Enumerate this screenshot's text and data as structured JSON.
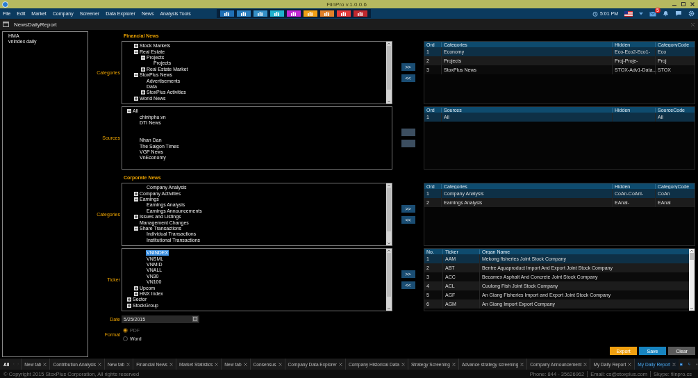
{
  "title_bar": {
    "title": "FiinPro v.1.0.0.6"
  },
  "menu": [
    "File",
    "Edit",
    "Market",
    "Company",
    "Screener",
    "Data Explorer",
    "News",
    "Analysis Tools"
  ],
  "toolbar": [
    {
      "color": "#1f6fb5"
    },
    {
      "color": "#2a7fc0"
    },
    {
      "color": "#3490c8"
    },
    {
      "color": "#1fb2cf"
    },
    {
      "color": "#c32bd6"
    },
    {
      "color": "#f0a015"
    },
    {
      "color": "#e0812a"
    },
    {
      "color": "#e53a3a"
    },
    {
      "color": "#c0282e"
    }
  ],
  "status": {
    "time": "5:01 PM",
    "mail_badge": "5"
  },
  "document": {
    "title": "NewsDailyReport"
  },
  "reports": [
    "HMA",
    "vnindex daily"
  ],
  "sections": [
    {
      "heading": "Financial News",
      "panels": [
        {
          "label": "Categories",
          "scrollbar": true,
          "buttons": [
            ">>",
            "<<"
          ],
          "tree": [
            {
              "children": [
                {
                  "label": "Stock Markets",
                  "expanded": false
                },
                {
                  "label": "Real Estate",
                  "expanded": true,
                  "children": [
                    {
                      "label": "Projects",
                      "expanded": true,
                      "children": [
                        {
                          "label": "Projects"
                        }
                      ]
                    },
                    {
                      "label": "Real Estate Market",
                      "expanded": false
                    }
                  ]
                },
                {
                  "label": "StoxPlus News",
                  "expanded": true,
                  "children": [
                    {
                      "label": "Advertisements"
                    },
                    {
                      "label": "Data"
                    },
                    {
                      "label": "StoxPlus Activities",
                      "expanded": false
                    }
                  ]
                },
                {
                  "label": "World News",
                  "expanded": false
                }
              ]
            }
          ],
          "table": {
            "columns": [
              "Ord",
              "Categories",
              "Hidden",
              "CategoryCode"
            ],
            "rows": [
              {
                "cells": [
                  "1",
                  "Economy",
                  "Eco-Eco2-Eco1-",
                  "Eco"
                ],
                "selected": true
              },
              {
                "cells": [
                  "2",
                  "Projects",
                  "Proj-Proje-",
                  "Proj"
                ],
                "selected": false
              },
              {
                "cells": [
                  "3",
                  "StoxPlus News",
                  "STOX-Adv1-Data...",
                  "STOX"
                ],
                "selected": false
              }
            ]
          }
        },
        {
          "label": "Sources",
          "tree": [
            {
              "label": "All",
              "expanded": true,
              "children": [
                {
                  "label": "chinhphu.vn"
                },
                {
                  "label": "DTI News"
                },
                {
                  "kind": "blank"
                },
                {
                  "kind": "blank"
                },
                {
                  "label": "Nhan Dan"
                },
                {
                  "label": "The Saigon Times"
                },
                {
                  "label": "VGP News"
                },
                {
                  "label": "VnEconomy"
                }
              ]
            }
          ],
          "table": {
            "columns": [
              "Ord",
              "Sources",
              "Hidden",
              "SourceCode"
            ],
            "rows": [
              {
                "cells": [
                  "1",
                  "All",
                  null,
                  "All"
                ],
                "selected": true
              }
            ]
          }
        }
      ]
    },
    {
      "heading": "Corporate News",
      "panels": [
        {
          "label": "Categories",
          "scrollbar": true,
          "buttons": [
            ">>",
            "<<"
          ],
          "tree": [
            {
              "children": [
                {
                  "children": [
                    {
                      "label": "Company Analysis"
                    }
                  ]
                },
                {
                  "label": "Company Activities",
                  "expanded": false
                },
                {
                  "label": "Earnings",
                  "expanded": true,
                  "children": [
                    {
                      "label": "Earnings Analysis"
                    },
                    {
                      "label": "Earnings Announcements"
                    }
                  ]
                },
                {
                  "label": "Issues and Listings",
                  "expanded": false
                },
                {
                  "label": "Management Changes"
                },
                {
                  "label": "Share Transactions",
                  "expanded": true,
                  "children": [
                    {
                      "label": "Individual Transactions"
                    },
                    {
                      "label": "Institutional Transactions"
                    }
                  ]
                }
              ]
            }
          ],
          "table": {
            "columns": [
              "Ord",
              "Categories",
              "Hidden",
              "CategoryCode"
            ],
            "rows": [
              {
                "cells": [
                  "1",
                  "Company Analysis",
                  "CoAn-CoAnl-",
                  "CoAn"
                ],
                "selected": true
              },
              {
                "cells": [
                  "2",
                  "Earnings Analysis",
                  "EAnal-",
                  "EAnal"
                ],
                "selected": false
              }
            ]
          }
        },
        {
          "label": "Ticker",
          "scrollbar": true,
          "buttons": [
            ">>",
            "<<"
          ],
          "tree": [
            {
              "children": [
                {
                  "children": [
                    {
                      "label": "VNINDEX",
                      "selected": true
                    },
                    {
                      "label": "VNSML",
                      "selected": false
                    },
                    {
                      "label": "VNMID",
                      "selected": false
                    },
                    {
                      "label": "VNALL",
                      "selected": false
                    },
                    {
                      "label": "VN30",
                      "selected": false
                    },
                    {
                      "label": "VN100",
                      "selected": false
                    }
                  ]
                },
                {
                  "label": "Upcom",
                  "expanded": false,
                  "selected": false
                },
                {
                  "label": "HNX Index",
                  "expanded": false,
                  "selected": false
                }
              ]
            },
            {
              "label": "Sector",
              "expanded": false,
              "selected": false
            },
            {
              "label": "StockGroup",
              "expanded": false,
              "selected": false
            }
          ],
          "table": {
            "scrollbar": true,
            "columns": [
              "No.",
              "Ticker",
              "Organ Name"
            ],
            "rows": [
              {
                "cells": [
                  "1",
                  "AAM",
                  "Mekong fisheries Joint Stock Company"
                ],
                "selected": true
              },
              {
                "cells": [
                  "2",
                  "ABT",
                  "Bentre Aquaproduct Import And Export Joint Stock Company"
                ],
                "selected": false
              },
              {
                "cells": [
                  "3",
                  "ACC",
                  "Becamex Asphalt And Concrete Joint Stock Company"
                ],
                "selected": false
              },
              {
                "cells": [
                  "4",
                  "ACL",
                  "Cuulong Fish Joint Stock Company"
                ],
                "selected": false
              },
              {
                "cells": [
                  "5",
                  "AGF",
                  "An Giang Fisheries Import and Export Joint Stock Company"
                ],
                "selected": false
              },
              {
                "cells": [
                  "6",
                  "AGM",
                  "An Giang Import Export Company"
                ],
                "selected": false
              }
            ]
          }
        }
      ]
    }
  ],
  "date": {
    "label": "Date",
    "value": "5/25/2015"
  },
  "format": {
    "label": "Format",
    "options": [
      {
        "label": "PDF",
        "selected": true,
        "disabled": true
      },
      {
        "label": "Word",
        "selected": false,
        "disabled": false
      }
    ]
  },
  "actions": [
    {
      "label": "Export",
      "kind": "export"
    },
    {
      "label": "Save",
      "kind": "save"
    },
    {
      "label": "Clear",
      "kind": "clear"
    }
  ],
  "tabs": {
    "all": "All",
    "items": [
      {
        "label": "New tab",
        "selected": false
      },
      {
        "label": "Contribution Analysis",
        "selected": false
      },
      {
        "label": "New tab",
        "selected": false
      },
      {
        "label": "Financial News",
        "selected": false
      },
      {
        "label": "Market Statistics",
        "selected": false
      },
      {
        "label": "New tab",
        "selected": false
      },
      {
        "label": "Consensus",
        "selected": false
      },
      {
        "label": "Company Data Explorer",
        "selected": false
      },
      {
        "label": "Company Historical Data",
        "selected": false
      },
      {
        "label": "Strategy Screening",
        "selected": false
      },
      {
        "label": "Advance strategy screening",
        "selected": false
      },
      {
        "label": "Company Announcement",
        "selected": false
      },
      {
        "label": "My Daily Report",
        "selected": false
      },
      {
        "label": "My Daily Report",
        "selected": true
      }
    ]
  },
  "footer": {
    "copyright": "© Copyright 2015 StoxPlus Corporation, All rights reserved",
    "contacts": [
      "Phone: 844 - 35626962",
      "Email: cs@stoxplus.com",
      "Skype: fiinpro.cs"
    ]
  }
}
